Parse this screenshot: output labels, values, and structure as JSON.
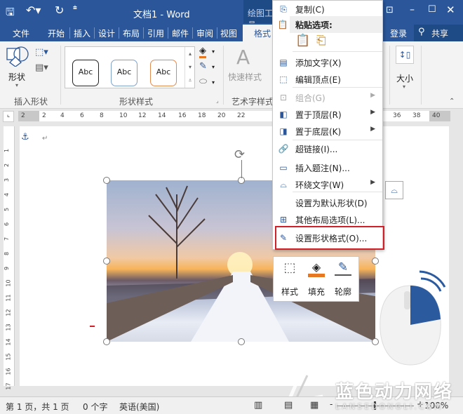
{
  "title": {
    "doc_title": "文档1 - Word",
    "context_tab": "绘图工具"
  },
  "tabs": [
    {
      "label": "文件"
    },
    {
      "label": "开始"
    },
    {
      "label": "插入"
    },
    {
      "label": "设计"
    },
    {
      "label": "布局"
    },
    {
      "label": "引用"
    },
    {
      "label": "邮件"
    },
    {
      "label": "审阅"
    },
    {
      "label": "视图"
    },
    {
      "label": "格式"
    }
  ],
  "account": {
    "login": "登录",
    "share": "共享"
  },
  "ribbon": {
    "shapes_label": "形状",
    "insert_shapes_group": "插入形状",
    "style_samples": [
      "Abc",
      "Abc",
      "Abc"
    ],
    "shape_styles_group": "形状样式",
    "quick_styles": "快速样式",
    "wordart_group": "艺术字样式",
    "size_label": "大小"
  },
  "ruler": {
    "h": [
      "2",
      "2",
      "4",
      "6",
      "8",
      "10",
      "12",
      "14",
      "16",
      "18",
      "20",
      "22",
      "36",
      "38",
      "40"
    ],
    "v": [
      "1",
      "2",
      "3",
      "4",
      "5",
      "6",
      "7",
      "8",
      "9",
      "10",
      "11",
      "12",
      "13",
      "14",
      "15",
      "16",
      "17"
    ]
  },
  "context_menu": {
    "items": [
      {
        "label": "复制(C)",
        "icon": "copy-icon"
      },
      {
        "label": "粘贴选项:",
        "icon": "paste-icon",
        "header": true
      },
      {
        "label": "添加文字(X)",
        "icon": "add-text-icon"
      },
      {
        "label": "编辑顶点(E)",
        "icon": "edit-points-icon"
      },
      {
        "label": "组合(G)",
        "icon": "group-icon",
        "disabled": true,
        "submenu": true
      },
      {
        "label": "置于顶层(R)",
        "icon": "bring-front-icon",
        "submenu": true
      },
      {
        "label": "置于底层(K)",
        "icon": "send-back-icon",
        "submenu": true
      },
      {
        "label": "超链接(I)...",
        "icon": "hyperlink-icon"
      },
      {
        "label": "插入题注(N)...",
        "icon": "caption-icon"
      },
      {
        "label": "环绕文字(W)",
        "icon": "wrap-text-icon",
        "submenu": true
      },
      {
        "label": "设置为默认形状(D)",
        "icon": ""
      },
      {
        "label": "其他布局选项(L)...",
        "icon": "layout-icon"
      },
      {
        "label": "设置形状格式(O)...",
        "icon": "format-shape-icon",
        "highlighted": true
      }
    ]
  },
  "mini_toolbar": [
    {
      "label": "样式"
    },
    {
      "label": "填充"
    },
    {
      "label": "轮廓"
    }
  ],
  "status": {
    "page": "第 1 页，共 1 页",
    "words": "0 个字",
    "language": "英语(美国)",
    "zoom": "100%"
  },
  "watermark": {
    "brand": "蓝色动力网络",
    "domain": "LANSEDONGLI.COM"
  },
  "colors": {
    "accent": "#2b579a",
    "highlight_box": "#d0202a",
    "fill": "#e87722"
  }
}
